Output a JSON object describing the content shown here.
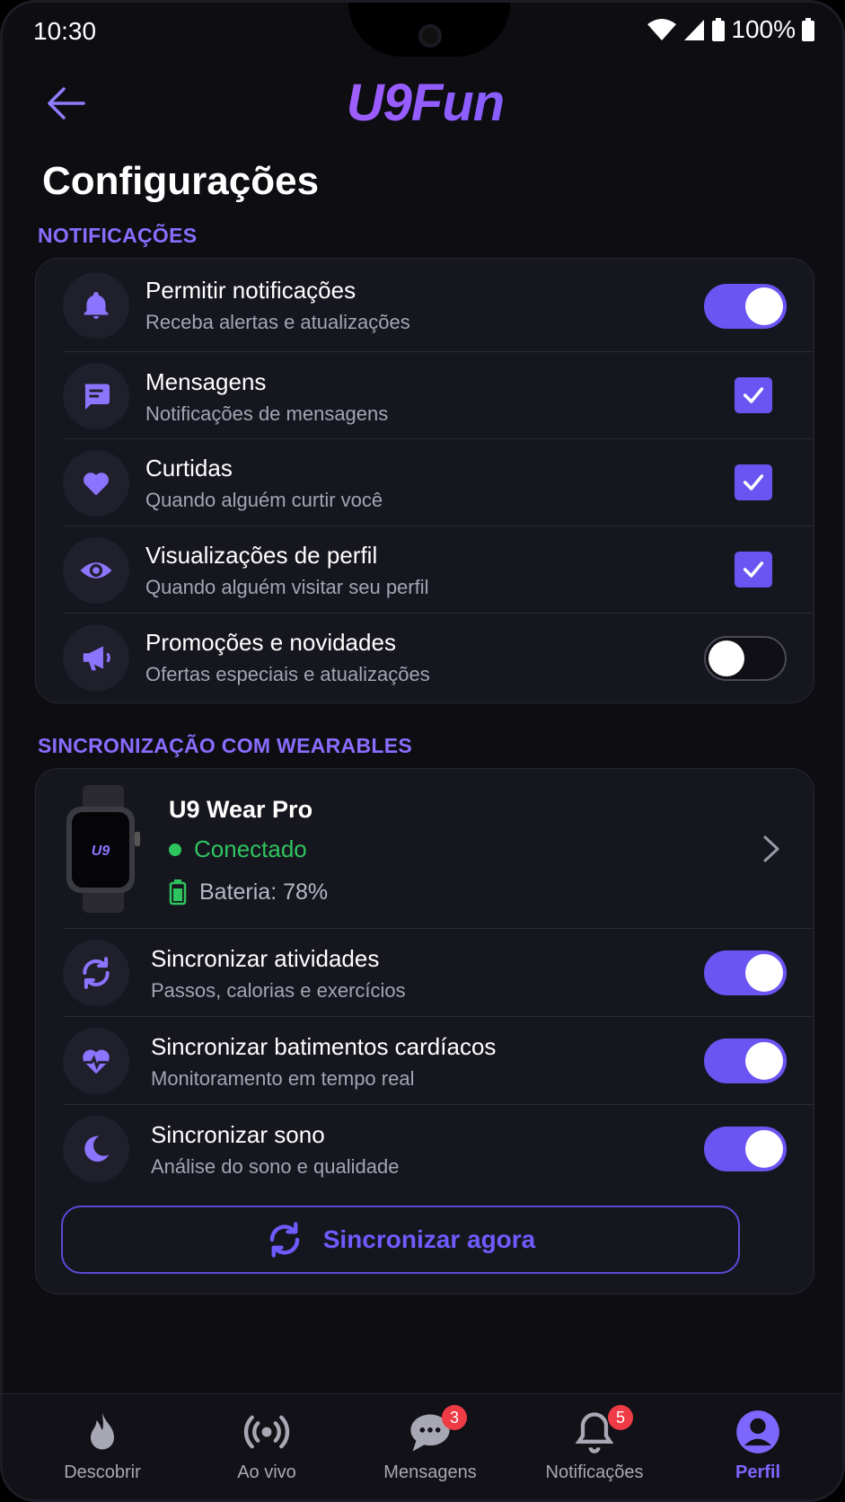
{
  "status_bar": {
    "time": "10:30",
    "battery": "100%"
  },
  "header": {
    "logo": "U9Fun",
    "title": "Configurações"
  },
  "notifications": {
    "label": "NOTIFICAÇÕES",
    "items": [
      {
        "icon": "bell-icon",
        "title": "Permitir notificações",
        "subtitle": "Receba alertas e atualizações",
        "control": "toggle",
        "on": true
      },
      {
        "icon": "message-icon",
        "title": "Mensagens",
        "subtitle": "Notificações de mensagens",
        "control": "checkbox",
        "checked": true
      },
      {
        "icon": "heart-icon",
        "title": "Curtidas",
        "subtitle": "Quando alguém curtir você",
        "control": "checkbox",
        "checked": true
      },
      {
        "icon": "eye-icon",
        "title": "Visualizações de perfil",
        "subtitle": "Quando alguém visitar seu perfil",
        "control": "checkbox",
        "checked": true
      },
      {
        "icon": "megaphone-icon",
        "title": "Promoções e novidades",
        "subtitle": "Ofertas especiais e atualizações",
        "control": "toggle",
        "on": false
      }
    ]
  },
  "wearables": {
    "label": "SINCRONIZAÇÃO COM WEARABLES",
    "device": {
      "name": "U9 Wear Pro",
      "watch_logo": "U9",
      "status": "Conectado",
      "battery": "Bateria: 78%"
    },
    "items": [
      {
        "icon": "sync-icon",
        "title": "Sincronizar atividades",
        "subtitle": "Passos, calorias e exercícios",
        "on": true
      },
      {
        "icon": "heartbeat-icon",
        "title": "Sincronizar batimentos cardíacos",
        "subtitle": "Monitoramento em tempo real",
        "on": true
      },
      {
        "icon": "moon-icon",
        "title": "Sincronizar sono",
        "subtitle": "Análise do sono e qualidade",
        "on": true
      }
    ],
    "sync_button": "Sincronizar agora"
  },
  "bottom_nav": {
    "items": [
      {
        "label": "Descobrir",
        "icon": "flame-icon"
      },
      {
        "label": "Ao vivo",
        "icon": "live-icon"
      },
      {
        "label": "Mensagens",
        "icon": "chat-icon",
        "badge": "3"
      },
      {
        "label": "Notificações",
        "icon": "bell-icon",
        "badge": "5"
      },
      {
        "label": "Perfil",
        "icon": "profile-icon",
        "active": true
      }
    ]
  },
  "colors": {
    "accent": "#6a54f2",
    "success": "#2ec55f",
    "badge": "#ef3b46",
    "background": "#0d0d12"
  }
}
